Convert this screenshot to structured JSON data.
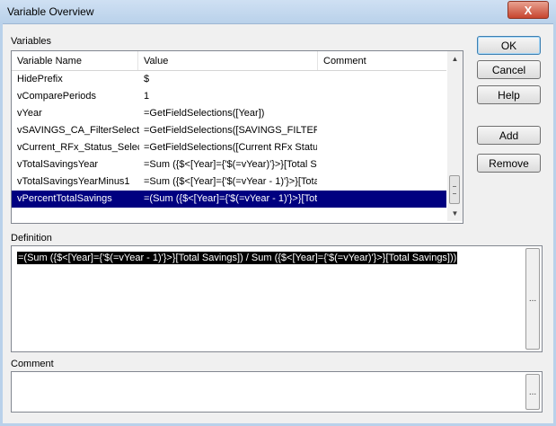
{
  "window": {
    "title": "Variable Overview",
    "close_glyph": "X"
  },
  "variables": {
    "label": "Variables",
    "columns": [
      "Variable Name",
      "Value",
      "Comment"
    ],
    "rows": [
      {
        "name": "HidePrefix",
        "value": "$",
        "comment": ""
      },
      {
        "name": "vComparePeriods",
        "value": "1",
        "comment": ""
      },
      {
        "name": "vYear",
        "value": "=GetFieldSelections([Year])",
        "comment": ""
      },
      {
        "name": "vSAVINGS_CA_FilterSelecti",
        "value": "=GetFieldSelections([SAVINGS_FILTER",
        "comment": ""
      },
      {
        "name": "vCurrent_RFx_Status_Selec",
        "value": "=GetFieldSelections([Current RFx Status",
        "comment": ""
      },
      {
        "name": "vTotalSavingsYear",
        "value": "=Sum ({$<[Year]={'$(=vYear)'}>}[Total Sa",
        "comment": ""
      },
      {
        "name": "vTotalSavingsYearMinus1",
        "value": "=Sum ({$<[Year]={'$(=vYear - 1)'}>}[Tota",
        "comment": ""
      },
      {
        "name": "vPercentTotalSavings",
        "value": "=(Sum ({$<[Year]={'$(=vYear - 1)'}>}[Tot",
        "comment": ""
      }
    ],
    "selected_index": 7
  },
  "buttons": {
    "ok": "OK",
    "cancel": "Cancel",
    "help": "Help",
    "add": "Add",
    "remove": "Remove"
  },
  "definition": {
    "label": "Definition",
    "value": "=(Sum ({$<[Year]={'$(=vYear - 1)'}>}[Total Savings]) / Sum ({$<[Year]={'$(=vYear)'}>}[Total Savings]))",
    "browse_label": "..."
  },
  "comment": {
    "label": "Comment",
    "value": "",
    "browse_label": "..."
  },
  "scrollbar": {
    "up_glyph": "▲",
    "down_glyph": "▼"
  }
}
